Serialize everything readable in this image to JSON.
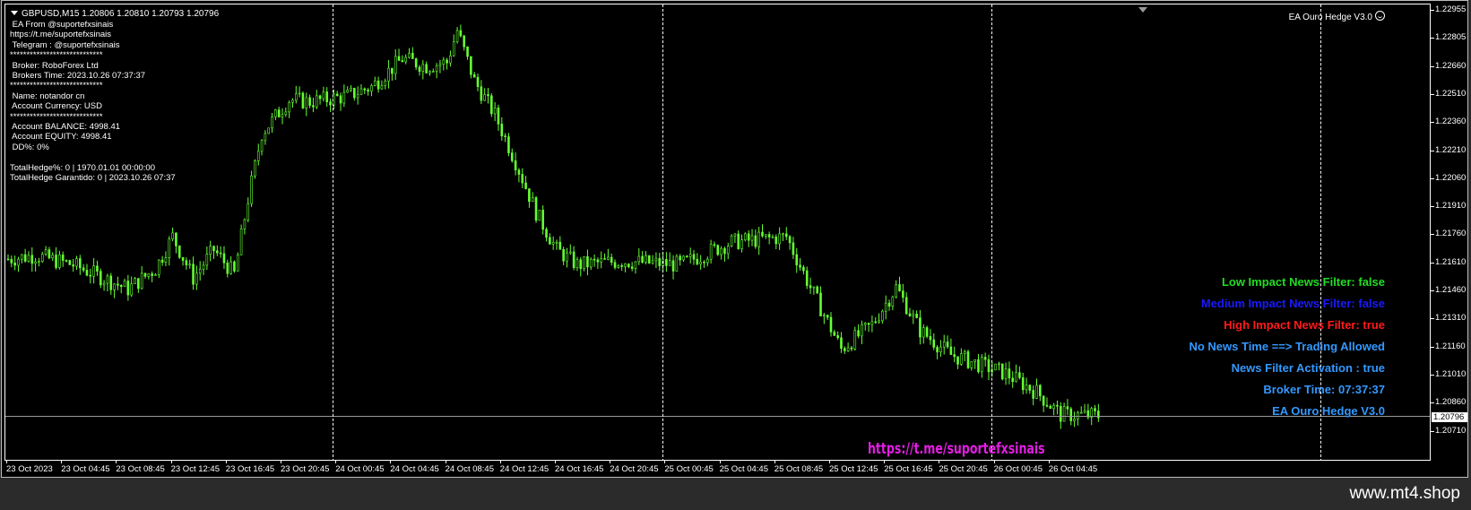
{
  "chart_header": {
    "symbol_line": "GBPUSD,M15  1.20806 1.20810 1.20793 1.20796"
  },
  "info_panel": {
    "lines": [
      " EA From @suportefxsinais",
      "https://t.me/suportefxsinais",
      " Telegram : @suportefxsinais",
      "****************************",
      " Broker: RoboForex Ltd",
      " Brokers Time: 2023.10.26 07:37:37",
      "****************************",
      " Name: notandor cn",
      " Account Currency: USD",
      "****************************",
      " Account BALANCE: 4998.41",
      " Account EQUITY: 4998.41",
      " DD%: 0%",
      "",
      "TotalHedge%: 0 | 1970.01.01 00:00:00",
      "TotalHedge Garantido: 0 | 2023.10.26 07:37"
    ]
  },
  "ea_title": "EA Ouro Hedge V3.0",
  "news_panel": [
    {
      "text": "Low Impact News Filter: false",
      "color": "#22dd22"
    },
    {
      "text": "Medium Impact News Filter: false",
      "color": "#1a1aff"
    },
    {
      "text": "High Impact News Filter: true",
      "color": "#ff1a1a"
    },
    {
      "text": "No News Time ==> Trading Allowed",
      "color": "#3399ff"
    },
    {
      "text": "News Filter Activation : true",
      "color": "#3399ff"
    },
    {
      "text": "Broker Time: 07:37:37",
      "color": "#3399ff"
    },
    {
      "text": "EA Ouro Hedge V3.0",
      "color": "#3399ff"
    }
  ],
  "watermark_link": "https://t.me/suportefxsinais",
  "footer_site": "www.mt4.shop",
  "price_scale": {
    "labels": [
      "1.22955",
      "1.22805",
      "1.22660",
      "1.22510",
      "1.22360",
      "1.22210",
      "1.22060",
      "1.21910",
      "1.21760",
      "1.21610",
      "1.21460",
      "1.21310",
      "1.21160",
      "1.21010",
      "1.20860",
      "1.20710"
    ],
    "current_price": "1.20796"
  },
  "time_axis": {
    "labels": [
      "23 Oct 2023",
      "23 Oct 04:45",
      "23 Oct 08:45",
      "23 Oct 12:45",
      "23 Oct 16:45",
      "23 Oct 20:45",
      "24 Oct 00:45",
      "24 Oct 04:45",
      "24 Oct 08:45",
      "24 Oct 12:45",
      "24 Oct 16:45",
      "24 Oct 20:45",
      "25 Oct 00:45",
      "25 Oct 04:45",
      "25 Oct 08:45",
      "25 Oct 12:45",
      "25 Oct 16:45",
      "25 Oct 20:45",
      "26 Oct 00:45",
      "26 Oct 04:45"
    ]
  },
  "chart_data": {
    "type": "candlestick",
    "symbol": "GBPUSD",
    "timeframe": "M15",
    "candle_color": "#66ff33",
    "ylim": [
      1.2071,
      1.22955
    ],
    "x_start": "23 Oct 2023",
    "x_end": "26 Oct 07:30",
    "close_path": [
      {
        "x": "23 Oct 00:00",
        "y": 1.2163
      },
      {
        "x": "23 Oct 02:00",
        "y": 1.2165
      },
      {
        "x": "23 Oct 04:45",
        "y": 1.216
      },
      {
        "x": "23 Oct 08:45",
        "y": 1.2147
      },
      {
        "x": "23 Oct 10:45",
        "y": 1.2158
      },
      {
        "x": "23 Oct 12:00",
        "y": 1.2175
      },
      {
        "x": "23 Oct 13:30",
        "y": 1.2153
      },
      {
        "x": "23 Oct 15:00",
        "y": 1.2168
      },
      {
        "x": "23 Oct 16:30",
        "y": 1.2155
      },
      {
        "x": "23 Oct 17:30",
        "y": 1.2195
      },
      {
        "x": "23 Oct 18:30",
        "y": 1.223
      },
      {
        "x": "23 Oct 20:30",
        "y": 1.2248
      },
      {
        "x": "23 Oct 22:00",
        "y": 1.2247
      },
      {
        "x": "24 Oct 00:45",
        "y": 1.225
      },
      {
        "x": "24 Oct 02:30",
        "y": 1.2255
      },
      {
        "x": "24 Oct 04:45",
        "y": 1.227
      },
      {
        "x": "24 Oct 06:30",
        "y": 1.2266
      },
      {
        "x": "24 Oct 08:00",
        "y": 1.2268
      },
      {
        "x": "24 Oct 08:45",
        "y": 1.2285
      },
      {
        "x": "24 Oct 10:00",
        "y": 1.2258
      },
      {
        "x": "24 Oct 11:30",
        "y": 1.224
      },
      {
        "x": "24 Oct 13:00",
        "y": 1.2215
      },
      {
        "x": "24 Oct 14:30",
        "y": 1.2188
      },
      {
        "x": "24 Oct 16:00",
        "y": 1.2168
      },
      {
        "x": "24 Oct 17:30",
        "y": 1.216
      },
      {
        "x": "24 Oct 20:45",
        "y": 1.2162
      },
      {
        "x": "25 Oct 01:00",
        "y": 1.216
      },
      {
        "x": "25 Oct 04:45",
        "y": 1.2172
      },
      {
        "x": "25 Oct 08:45",
        "y": 1.2175
      },
      {
        "x": "25 Oct 10:30",
        "y": 1.2148
      },
      {
        "x": "25 Oct 12:45",
        "y": 1.2115
      },
      {
        "x": "25 Oct 15:00",
        "y": 1.2128
      },
      {
        "x": "25 Oct 16:45",
        "y": 1.2148
      },
      {
        "x": "25 Oct 18:30",
        "y": 1.2125
      },
      {
        "x": "25 Oct 20:45",
        "y": 1.2112
      },
      {
        "x": "26 Oct 00:45",
        "y": 1.2102
      },
      {
        "x": "26 Oct 03:00",
        "y": 1.2092
      },
      {
        "x": "26 Oct 04:45",
        "y": 1.208
      },
      {
        "x": "26 Oct 07:30",
        "y": 1.20796
      }
    ]
  }
}
